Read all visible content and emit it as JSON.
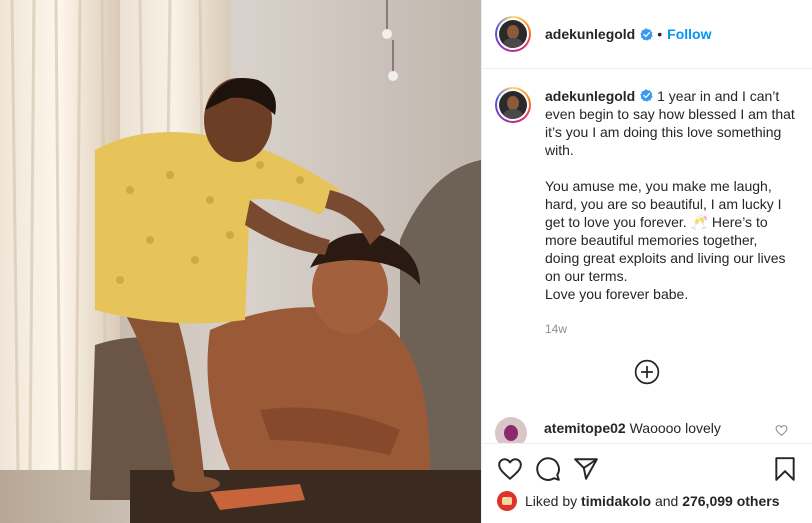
{
  "header": {
    "username": "adekunlegold",
    "separator": "•",
    "follow_label": "Follow"
  },
  "caption": {
    "username": "adekunlegold",
    "text": "1 year in and I can’t even begin to say how blessed I am that it’s you I am doing this love something with.\n\nYou amuse me, you make me laugh, hard, you are so beautiful, I am lucky I get to love you forever. 🥂 Here’s to more beautiful memories together, doing great exploits and living our lives on our terms.\nLove you forever babe.",
    "time": "14w"
  },
  "comment": {
    "username": "atemitope02",
    "text": "Waoooo lovely"
  },
  "likes": {
    "prefix": "Liked by",
    "user": "timidakolo",
    "joiner": "and",
    "count": "276,099 others"
  },
  "icons": {
    "verified": "verified-badge-icon",
    "like": "heart-outline-icon",
    "comment": "comment-bubble-icon",
    "share": "paper-plane-icon",
    "save": "bookmark-icon",
    "more": "plus-circle-icon"
  },
  "colors": {
    "accent": "#0095f6",
    "text": "#262626",
    "muted": "#8e8e8e",
    "border": "#efefef"
  }
}
